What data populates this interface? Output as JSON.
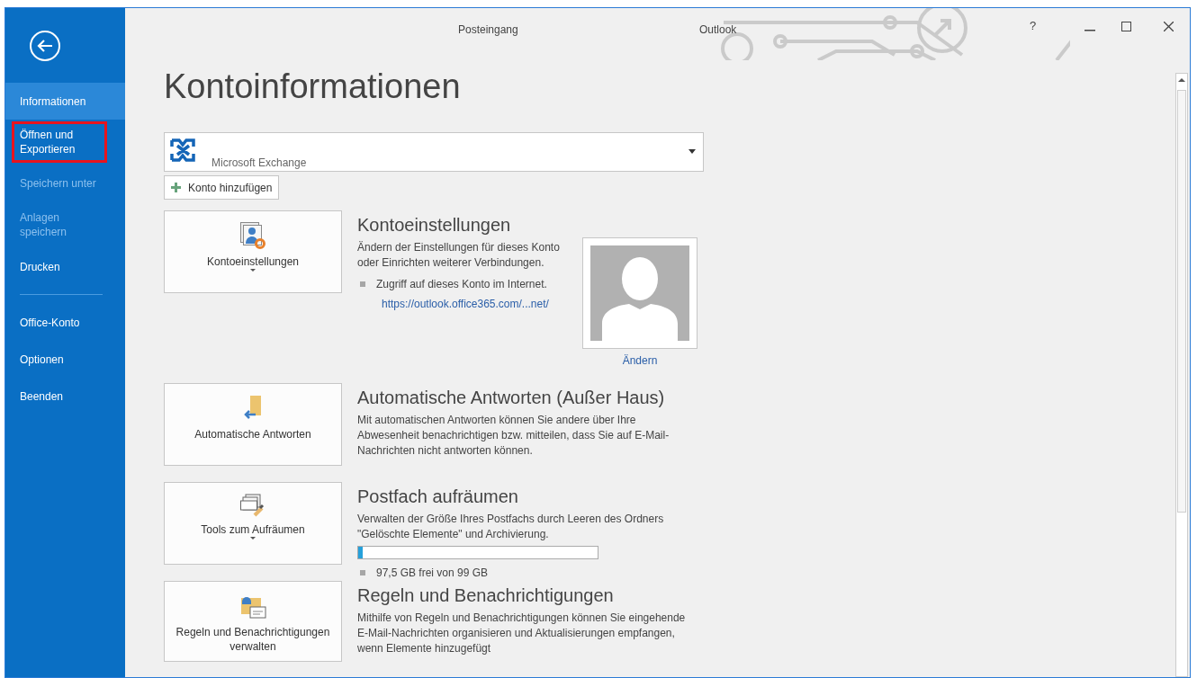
{
  "window": {
    "title": "Outlook",
    "folder": "Posteingang",
    "controls": [
      "?"
    ]
  },
  "sidebar": {
    "items": [
      {
        "label": "Informationen",
        "selected": true,
        "disabled": false,
        "highlighted": false,
        "divider_after": false
      },
      {
        "label": "Öffnen und Exportieren",
        "selected": false,
        "disabled": false,
        "highlighted": true,
        "divider_after": false
      },
      {
        "label": "Speichern unter",
        "selected": false,
        "disabled": true,
        "highlighted": false,
        "divider_after": false
      },
      {
        "label": "Anlagen speichern",
        "selected": false,
        "disabled": true,
        "highlighted": false,
        "divider_after": false
      },
      {
        "label": "Drucken",
        "selected": false,
        "disabled": false,
        "highlighted": false,
        "divider_after": true
      },
      {
        "label": "Office-Konto",
        "selected": false,
        "disabled": false,
        "highlighted": false,
        "divider_after": false
      },
      {
        "label": "Optionen",
        "selected": false,
        "disabled": false,
        "highlighted": false,
        "divider_after": false
      },
      {
        "label": "Beenden",
        "selected": false,
        "disabled": false,
        "highlighted": false,
        "divider_after": false
      }
    ]
  },
  "page_title": "Kontoinformationen",
  "account": {
    "name": "Microsoft Exchange"
  },
  "add_account": "Konto hinzufügen",
  "sections": [
    {
      "kind": "account",
      "button": "Kontoeinstellungen",
      "button_dropdown": true,
      "title": "Kontoeinstellungen",
      "description": "Ändern der Einstellungen für dieses Konto oder Einrichten weiterer Verbindungen.",
      "bullet": "Zugriff auf dieses Konto im Internet.",
      "link": "https://outlook.office365.com/...net/",
      "photo_link": "Ändern"
    },
    {
      "kind": "autoreply",
      "button": "Automatische Antworten",
      "button_dropdown": false,
      "title": "Automatische Antworten (Außer Haus)",
      "description": "Mit automatischen Antworten können Sie andere über Ihre Abwesenheit benachrichtigen bzw. mitteilen, dass Sie auf E-Mail-Nachrichten nicht antworten können."
    },
    {
      "kind": "cleanup",
      "button": "Tools zum Aufräumen",
      "button_dropdown": true,
      "title": "Postfach aufräumen",
      "description": "Verwalten der Größe Ihres Postfachs durch Leeren des Ordners \"Gelöschte Elemente\" und Archivierung.",
      "level": 0.02,
      "bullet": "97,5 GB frei von 99 GB"
    },
    {
      "kind": "rules",
      "button": "Regeln und Benachrichtigungen verwalten",
      "button_dropdown": false,
      "title": "Regeln und Benachrichtigungen",
      "description": "Mithilfe von Regeln und Benachrichtigungen können Sie eingehende E-Mail-Nachrichten organisieren und Aktualisierungen empfangen, wenn Elemente hinzugefügt"
    }
  ]
}
